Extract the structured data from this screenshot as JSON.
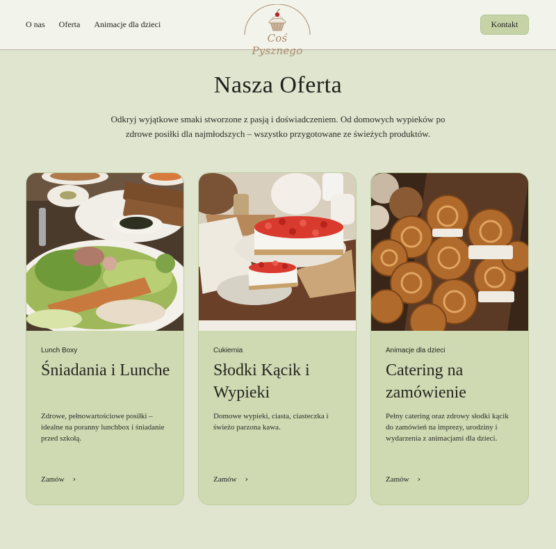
{
  "header": {
    "nav": [
      "O nas",
      "Oferta",
      "Animacje dla dzieci"
    ],
    "logo_text": "Coś Pysznego",
    "contact_label": "Kontakt"
  },
  "hero": {
    "title": "Nasza Oferta",
    "subtitle": "Odkryj wyjątkowe smaki stworzone z pasją i doświadczeniem. Od domowych wypieków po zdrowe posiłki dla najmłodszych – wszystko przygotowane ze świeżych produktów."
  },
  "cards": [
    {
      "category": "Lunch Boxy",
      "title": "Śniadania i Lunche",
      "description": "Zdrowe, pełnowartościowe posiłki – idealne na poranny lunchbox i śniadanie przed szkołą.",
      "cta": "Zamów"
    },
    {
      "category": "Cukiernia",
      "title": "Słodki Kącik i Wypieki",
      "description": "Domowe wypieki, ciasta, ciasteczka i świeżo parzona kawa.",
      "cta": "Zamów"
    },
    {
      "category": "Animacje dla dzieci",
      "title": "Catering na zamówienie",
      "description": "Pełny catering oraz zdrowy słodki kącik do zamówień na imprezy, urodziny i wydarzenia z animacjami dla dzieci.",
      "cta": "Zamów"
    }
  ],
  "colors": {
    "page_bg": "#dfe5cf",
    "header_bg": "#f2f4ec",
    "card_bg": "#cfdab3",
    "button_bg": "#c6d3a7",
    "logo_accent": "#a8876b"
  }
}
